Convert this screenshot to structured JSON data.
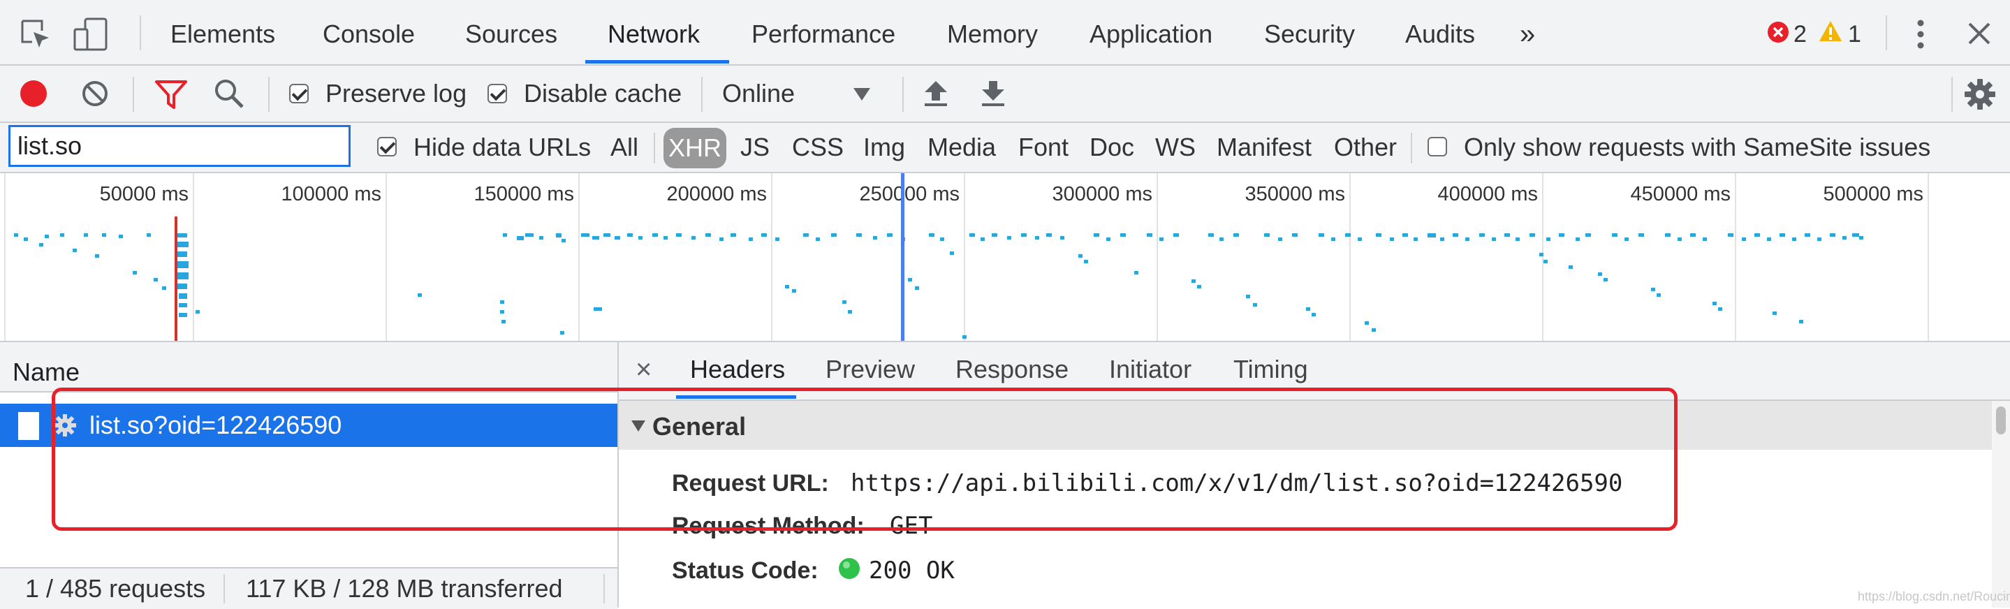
{
  "colors": {
    "accent": "#1a73e8",
    "record": "#e8202a",
    "filter": "#e8202a",
    "bar": "#2aa6de",
    "highlight": "#e8202a",
    "ok": "#2ec24a"
  },
  "tabs": [
    "Elements",
    "Console",
    "Sources",
    "Network",
    "Performance",
    "Memory",
    "Application",
    "Security",
    "Audits"
  ],
  "tabs_overflow": "»",
  "active_tab": "Network",
  "issues": {
    "errors": "2",
    "warnings": "1"
  },
  "toolbar": {
    "preserve_log": "Preserve log",
    "disable_cache": "Disable cache",
    "throttle": "Online"
  },
  "filter": {
    "value": "list.so",
    "hide_data_urls": "Hide data URLs",
    "types": [
      "All",
      "XHR",
      "JS",
      "CSS",
      "Img",
      "Media",
      "Font",
      "Doc",
      "WS",
      "Manifest",
      "Other"
    ],
    "active_type": "XHR",
    "samesite": "Only show requests with SameSite issues"
  },
  "timeline": {
    "ticks": [
      "50000 ms",
      "100000 ms",
      "150000 ms",
      "200000 ms",
      "250000 ms",
      "300000 ms",
      "350000 ms",
      "400000 ms",
      "450000 ms",
      "500000 ms"
    ]
  },
  "requests": {
    "column": "Name",
    "items": [
      "list.so?oid=122426590"
    ]
  },
  "status": {
    "count": "1 / 485 requests",
    "transferred": "117 KB / 128 MB transferred"
  },
  "detail_tabs": [
    "Headers",
    "Preview",
    "Response",
    "Initiator",
    "Timing"
  ],
  "close_glyph": "×",
  "general": {
    "title": "General",
    "request_url_label": "Request URL:",
    "request_url": "https://api.bilibili.com/x/v1/dm/list.so?oid=122426590",
    "method_label": "Request Method:",
    "method": "GET",
    "status_label": "Status Code:",
    "status": "200 OK"
  },
  "watermark": "https://blog.csdn.net/Roucinsi"
}
